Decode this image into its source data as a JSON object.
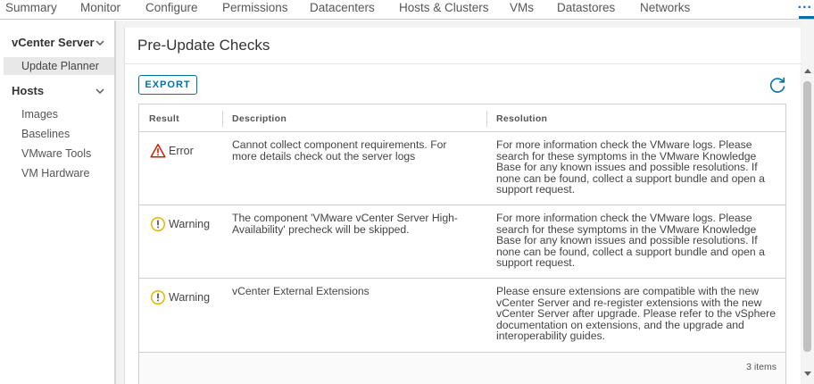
{
  "tabs": [
    "Summary",
    "Monitor",
    "Configure",
    "Permissions",
    "Datacenters",
    "Hosts & Clusters",
    "VMs",
    "Datastores",
    "Networks"
  ],
  "tabs_more": "...",
  "sidebar": {
    "groups": [
      {
        "label": "vCenter Server",
        "items": [
          "Update Planner"
        ]
      },
      {
        "label": "Hosts",
        "items": [
          "Images",
          "Baselines",
          "VMware Tools",
          "VM Hardware"
        ]
      }
    ],
    "active_item": "Update Planner"
  },
  "main": {
    "title": "Pre-Update Checks",
    "export_label": "EXPORT",
    "refresh_icon": "refresh-icon"
  },
  "grid": {
    "columns": [
      "Result",
      "Description",
      "Resolution"
    ],
    "rows": [
      {
        "result": "Error",
        "icon": "error-triangle-icon",
        "description": "Cannot collect component requirements. For more details check out the server logs",
        "resolution": "For more information check the VMware logs. Please search for these symptoms in the VMware Knowledge Base for any known issues and possible resolutions. If none can be found, collect a support bundle and open a support request."
      },
      {
        "result": "Warning",
        "icon": "warning-circle-icon",
        "description": "The component 'VMware vCenter Server High-Availability' precheck will be skipped.",
        "resolution": "For more information check the VMware logs. Please search for these symptoms in the VMware Knowledge Base for any known issues and possible resolutions. If none can be found, collect a support bundle and open a support request."
      },
      {
        "result": "Warning",
        "icon": "warning-circle-icon",
        "description": "vCenter External Extensions",
        "resolution": "Please ensure extensions are compatible with the new vCenter Server and re-register extensions with the new vCenter Server after upgrade. Please refer to the vSphere documentation on extensions, and the upgrade and interoperability guides."
      }
    ],
    "footer_count": "3 items"
  },
  "colors": {
    "accent": "#0072a3",
    "error": "#c92100",
    "warning": "#e8b600"
  }
}
